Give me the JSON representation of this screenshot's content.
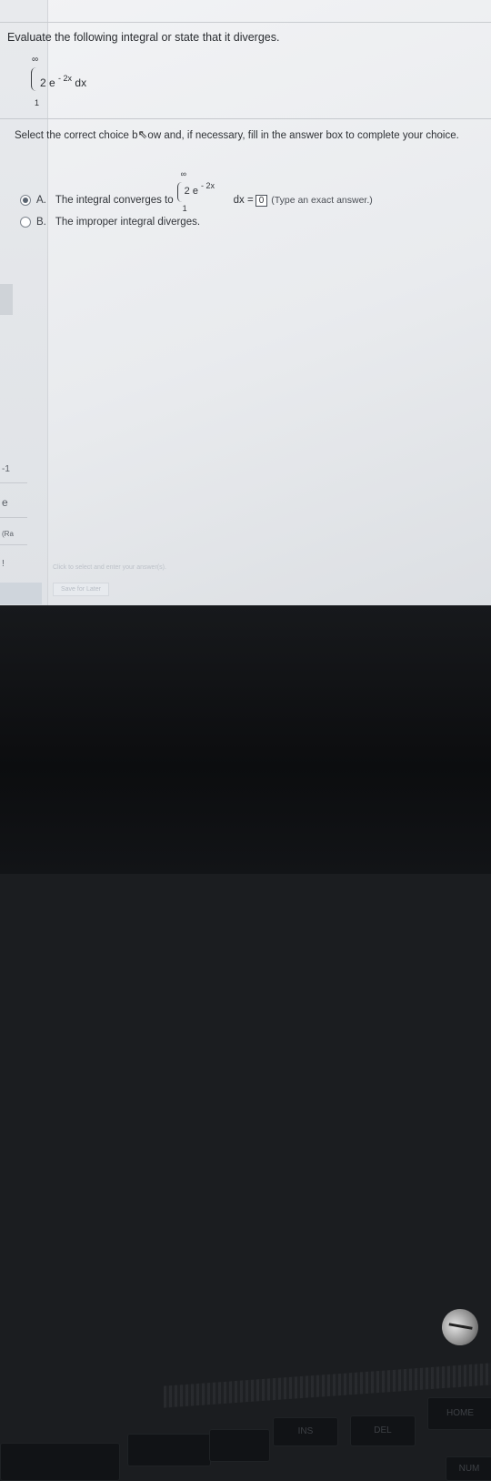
{
  "question": {
    "prompt": "Evaluate the following integral or state that it diverges.",
    "upper_bound": "∞",
    "lower_bound": "1",
    "integrand_coeff": "2 e",
    "integrand_exp": "- 2x",
    "differential": "dx"
  },
  "instruction": {
    "text_before_cursor": "Select the correct choice b",
    "text_after_cursor": "ow and, if necessary, fill in the answer box to complete your choice."
  },
  "choices": [
    {
      "letter": "A.",
      "text": "The integral converges to",
      "integral_upper": "∞",
      "integral_lower": "1",
      "integral_coeff": "2 e",
      "integral_exp": "- 2x",
      "integral_tail": "dx =",
      "answer_value": "0",
      "hint": "(Type an exact answer.)",
      "selected": true
    },
    {
      "letter": "B.",
      "text": "The improper integral diverges.",
      "selected": false
    }
  ],
  "footer": {
    "click_hint": "Click to select and enter your answer(s).",
    "save_later": "Save for Later"
  },
  "left_strip": {
    "marks": [
      "-1",
      "e",
      "(Ra",
      "!"
    ]
  },
  "keyboard": {
    "ins": "INS",
    "del": "DEL",
    "home": "HOME",
    "num": "NUM"
  }
}
